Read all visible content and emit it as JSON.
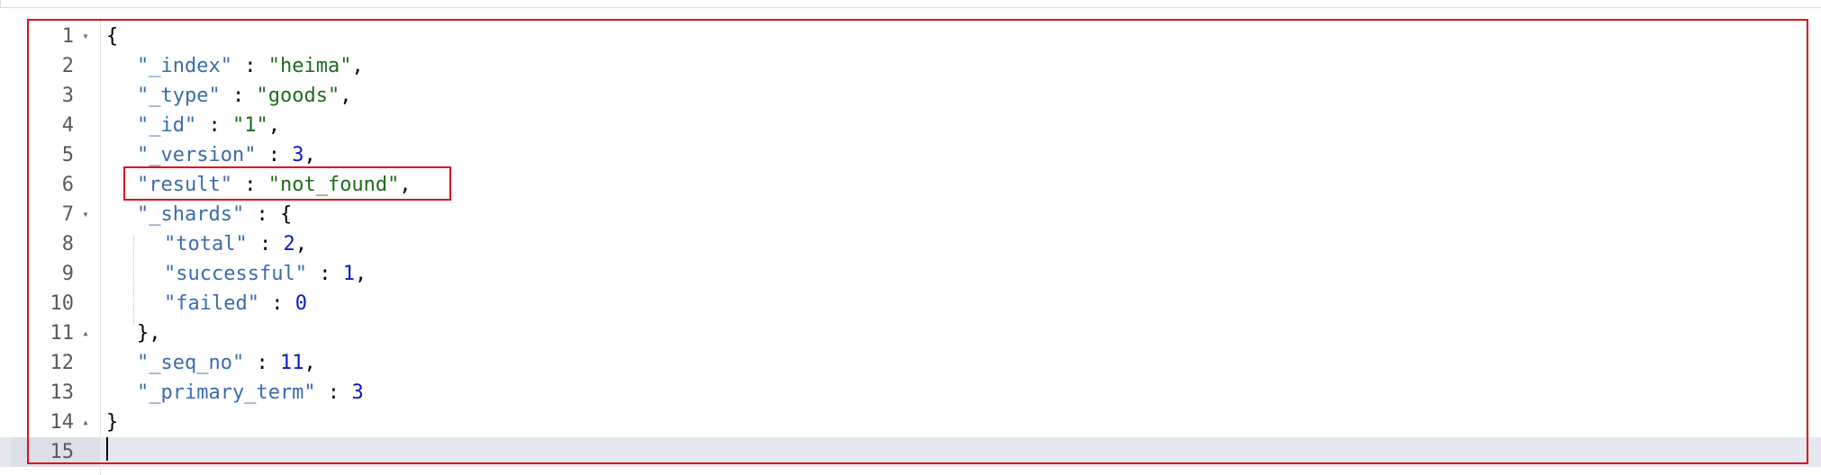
{
  "editor": {
    "lines": [
      {
        "num": "1",
        "fold": "▾",
        "text": "{"
      },
      {
        "num": "2",
        "fold": "",
        "key": "\"_index\"",
        "sep": " : ",
        "val": "\"heima\"",
        "vtype": "s",
        "tail": ","
      },
      {
        "num": "3",
        "fold": "",
        "key": "\"_type\"",
        "sep": " : ",
        "val": "\"goods\"",
        "vtype": "s",
        "tail": ","
      },
      {
        "num": "4",
        "fold": "",
        "key": "\"_id\"",
        "sep": " : ",
        "val": "\"1\"",
        "vtype": "s",
        "tail": ","
      },
      {
        "num": "5",
        "fold": "",
        "key": "\"_version\"",
        "sep": " : ",
        "val": "3",
        "vtype": "n",
        "tail": ","
      },
      {
        "num": "6",
        "fold": "",
        "key": "\"result\"",
        "sep": " : ",
        "val": "\"not_found\"",
        "vtype": "s",
        "tail": ","
      },
      {
        "num": "7",
        "fold": "▾",
        "key": "\"_shards\"",
        "sep": " : ",
        "val": "{",
        "vtype": "p",
        "tail": ""
      },
      {
        "num": "8",
        "fold": "",
        "key": "\"total\"",
        "sep": " : ",
        "val": "2",
        "vtype": "n",
        "tail": ","
      },
      {
        "num": "9",
        "fold": "",
        "key": "\"successful\"",
        "sep": " : ",
        "val": "1",
        "vtype": "n",
        "tail": ","
      },
      {
        "num": "10",
        "fold": "",
        "key": "\"failed\"",
        "sep": " : ",
        "val": "0",
        "vtype": "n",
        "tail": ""
      },
      {
        "num": "11",
        "fold": "▴",
        "text": "},"
      },
      {
        "num": "12",
        "fold": "",
        "key": "\"_seq_no\"",
        "sep": " : ",
        "val": "11",
        "vtype": "n",
        "tail": ","
      },
      {
        "num": "13",
        "fold": "",
        "key": "\"_primary_term\"",
        "sep": " : ",
        "val": "3",
        "vtype": "n",
        "tail": ""
      },
      {
        "num": "14",
        "fold": "▴",
        "text": "}"
      },
      {
        "num": "15",
        "fold": "",
        "text": ""
      }
    ],
    "active_line": "15"
  },
  "colors": {
    "key": "#3a6bb0",
    "string": "#1e6b1e",
    "number": "#0a1ac4",
    "annotation": "#d9141e"
  }
}
